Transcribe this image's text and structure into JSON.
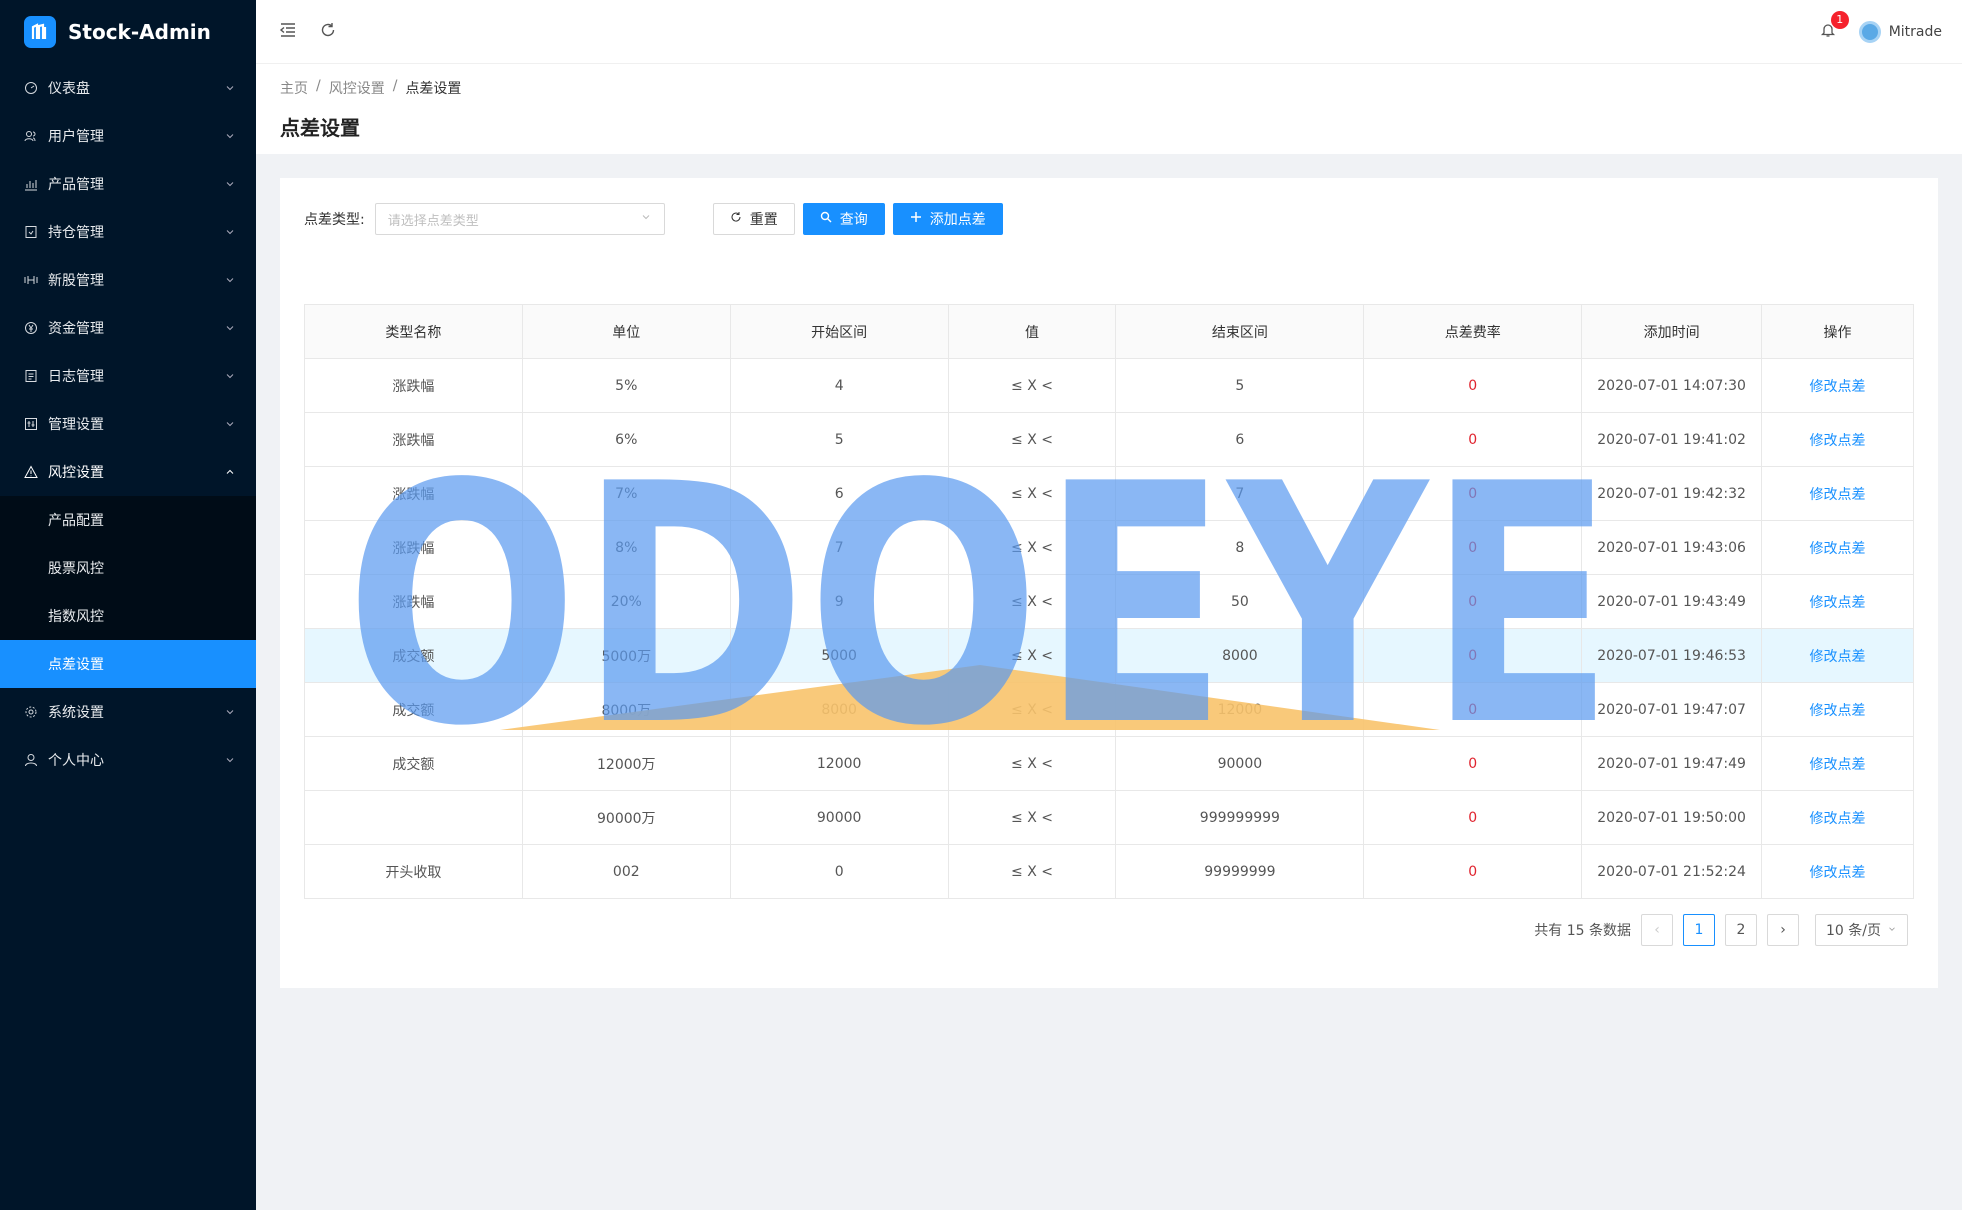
{
  "app": {
    "name": "Stock-Admin"
  },
  "sidebar": {
    "items": [
      {
        "label": "仪表盘",
        "icon": "dashboard-icon"
      },
      {
        "label": "用户管理",
        "icon": "users-icon"
      },
      {
        "label": "产品管理",
        "icon": "chart-icon"
      },
      {
        "label": "持仓管理",
        "icon": "position-icon"
      },
      {
        "label": "新股管理",
        "icon": "ipo-icon"
      },
      {
        "label": "资金管理",
        "icon": "money-icon"
      },
      {
        "label": "日志管理",
        "icon": "log-icon"
      },
      {
        "label": "管理设置",
        "icon": "settings-grid-icon"
      },
      {
        "label": "风控设置",
        "icon": "warning-icon"
      },
      {
        "label": "系统设置",
        "icon": "gear-icon"
      },
      {
        "label": "个人中心",
        "icon": "user-icon"
      }
    ],
    "sub": [
      {
        "label": "产品配置"
      },
      {
        "label": "股票风控"
      },
      {
        "label": "指数风控"
      },
      {
        "label": "点差设置"
      }
    ]
  },
  "header": {
    "badge": "1",
    "user": "Mitrade"
  },
  "breadcrumb": {
    "home": "主页",
    "sep": "/",
    "parent": "风控设置",
    "current": "点差设置"
  },
  "page": {
    "title": "点差设置"
  },
  "filter": {
    "label": "点差类型:",
    "placeholder": "请选择点差类型",
    "reset": "重置",
    "query": "查询",
    "add": "添加点差"
  },
  "table": {
    "headers": [
      "类型名称",
      "单位",
      "开始区间",
      "值",
      "结束区间",
      "点差费率",
      "添加时间",
      "操作"
    ],
    "rows": [
      [
        "涨跌幅",
        "5%",
        "4",
        "≤ X <",
        "5",
        "0",
        "2020-07-01 14:07:30",
        "修改点差"
      ],
      [
        "涨跌幅",
        "6%",
        "5",
        "≤ X <",
        "6",
        "0",
        "2020-07-01 19:41:02",
        "修改点差"
      ],
      [
        "涨跌幅",
        "7%",
        "6",
        "≤ X <",
        "7",
        "0",
        "2020-07-01 19:42:32",
        "修改点差"
      ],
      [
        "涨跌幅",
        "8%",
        "7",
        "≤ X <",
        "8",
        "0",
        "2020-07-01 19:43:06",
        "修改点差"
      ],
      [
        "涨跌幅",
        "20%",
        "9",
        "≤ X <",
        "50",
        "0",
        "2020-07-01 19:43:49",
        "修改点差"
      ],
      [
        "成交额",
        "5000万",
        "5000",
        "≤ X <",
        "8000",
        "0",
        "2020-07-01 19:46:53",
        "修改点差"
      ],
      [
        "成交额",
        "8000万",
        "8000",
        "≤ X <",
        "12000",
        "0",
        "2020-07-01 19:47:07",
        "修改点差"
      ],
      [
        "成交额",
        "12000万",
        "12000",
        "≤ X <",
        "90000",
        "0",
        "2020-07-01 19:47:49",
        "修改点差"
      ],
      [
        "",
        "90000万",
        "90000",
        "≤ X <",
        "999999999",
        "0",
        "2020-07-01 19:50:00",
        "修改点差"
      ],
      [
        "开头收取",
        "002",
        "0",
        "≤ X <",
        "99999999",
        "0",
        "2020-07-01 21:52:24",
        "修改点差"
      ]
    ]
  },
  "pagination": {
    "total": "共有 15 条数据",
    "pages": [
      "1",
      "2"
    ],
    "size": "10 条/页"
  },
  "watermark": {
    "text": "ODOEYE"
  },
  "colors": {
    "accent": "#1890ff",
    "sidebar": "#001529",
    "rate": "#e0242f"
  }
}
